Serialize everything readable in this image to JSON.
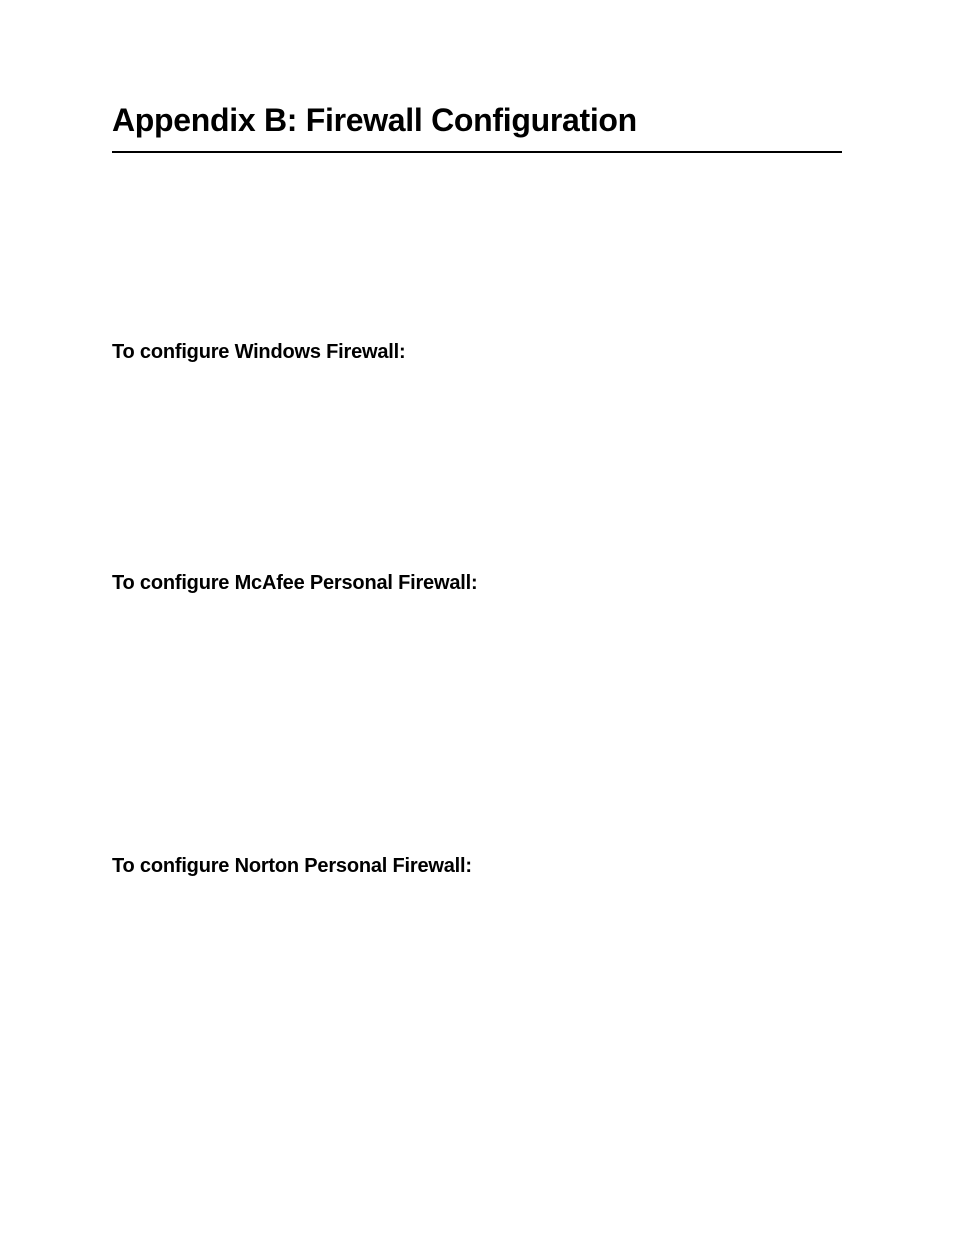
{
  "title": "Appendix B: Firewall Configuration",
  "sections": {
    "windows": "To configure Windows Firewall:",
    "mcafee": "To configure McAfee Personal Firewall:",
    "norton": "To configure Norton Personal Firewall:"
  }
}
